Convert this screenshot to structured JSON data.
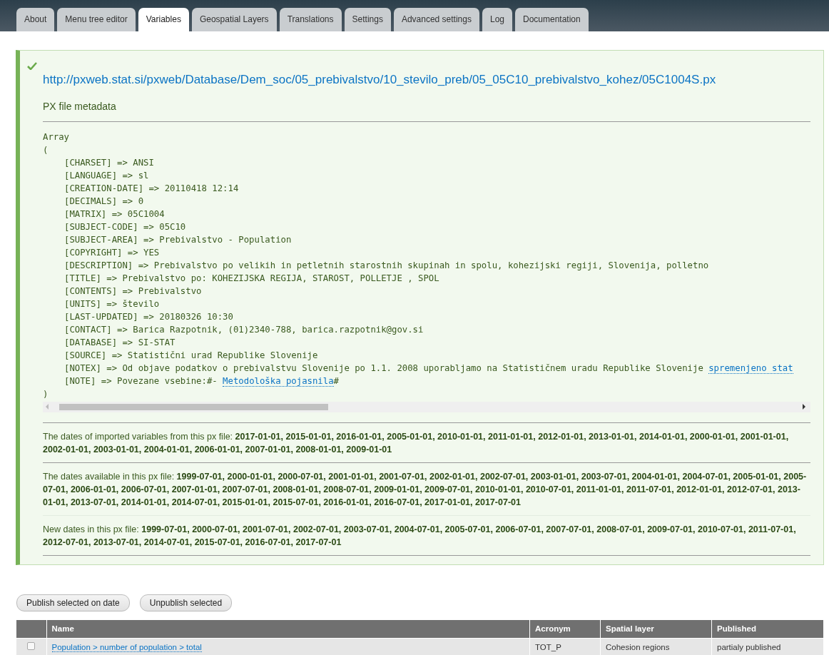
{
  "tabs": [
    {
      "label": "About",
      "selected": false
    },
    {
      "label": "Menu tree editor",
      "selected": false
    },
    {
      "label": "Variables",
      "selected": true
    },
    {
      "label": "Geospatial Layers",
      "selected": false
    },
    {
      "label": "Translations",
      "selected": false
    },
    {
      "label": "Settings",
      "selected": false
    },
    {
      "label": "Advanced settings",
      "selected": false
    },
    {
      "label": "Log",
      "selected": false
    },
    {
      "label": "Documentation",
      "selected": false
    }
  ],
  "message": {
    "url": "http://pxweb.stat.si/pxweb/Database/Dem_soc/05_prebivalstvo/10_stevilo_preb/05_05C10_prebivalstvo_kohez/05C1004S.px",
    "heading": "PX file metadata",
    "dump": {
      "open_lines": [
        "Array",
        "("
      ],
      "entries": [
        {
          "text": "[CHARSET] => ANSI"
        },
        {
          "text": "[LANGUAGE] => sl"
        },
        {
          "text": "[CREATION-DATE] => 20110418 12:14"
        },
        {
          "text": "[DECIMALS] => 0"
        },
        {
          "text": "[MATRIX] => 05C1004"
        },
        {
          "text": "[SUBJECT-CODE] => 05C10"
        },
        {
          "text": "[SUBJECT-AREA] => Prebivalstvo - Population"
        },
        {
          "text": "[COPYRIGHT] => YES"
        },
        {
          "text": "[DESCRIPTION] => Prebivalstvo po velikih in petletnih starostnih skupinah in spolu, kohezijski regiji, Slovenija, polletno"
        },
        {
          "text": "[TITLE] => Prebivalstvo po: KOHEZIJSKA REGIJA, STAROST, POLLETJE , SPOL"
        },
        {
          "text": "[CONTENTS] => Prebivalstvo"
        },
        {
          "text": "[UNITS] => število"
        },
        {
          "text": "[LAST-UPDATED] => 20180326 10:30"
        },
        {
          "text": "[CONTACT] => Barica Razpotnik, (01)2340-788, barica.razpotnik@gov.si"
        },
        {
          "text": "[DATABASE] => SI-STAT"
        },
        {
          "text": "[SOURCE] => Statistični urad Republike Slovenije"
        },
        {
          "text": "[NOTEX] => Od objave podatkov o prebivalstvu Slovenije po 1.1. 2008 uporabljamo na Statističnem uradu Republike Slovenije",
          "link": "spremenjeno stat"
        },
        {
          "text": "[NOTE] => Povezane vsebine:#-",
          "link": "Metodološka pojasnila",
          "tail": "#"
        }
      ],
      "close_line": ")"
    },
    "date_sections": [
      {
        "label": "The dates of imported variables from this px file:",
        "dates": "2017-01-01, 2015-01-01, 2016-01-01, 2005-01-01, 2010-01-01, 2011-01-01, 2012-01-01, 2013-01-01, 2014-01-01, 2000-01-01, 2001-01-01, 2002-01-01, 2003-01-01, 2004-01-01, 2006-01-01, 2007-01-01, 2008-01-01, 2009-01-01"
      },
      {
        "label": "The dates available in this px file:",
        "dates": "1999-07-01, 2000-01-01, 2000-07-01, 2001-01-01, 2001-07-01, 2002-01-01, 2002-07-01, 2003-01-01, 2003-07-01, 2004-01-01, 2004-07-01, 2005-01-01, 2005-07-01, 2006-01-01, 2006-07-01, 2007-01-01, 2007-07-01, 2008-01-01, 2008-07-01, 2009-01-01, 2009-07-01, 2010-01-01, 2010-07-01, 2011-01-01, 2011-07-01, 2012-01-01, 2012-07-01, 2013-01-01, 2013-07-01, 2014-01-01, 2014-07-01, 2015-01-01, 2015-07-01, 2016-01-01, 2016-07-01, 2017-01-01, 2017-07-01"
      },
      {
        "label": "New dates in this px file:",
        "dates": "1999-07-01, 2000-07-01, 2001-07-01, 2002-07-01, 2003-07-01, 2004-07-01, 2005-07-01, 2006-07-01, 2007-07-01, 2008-07-01, 2009-07-01, 2010-07-01, 2011-07-01, 2012-07-01, 2013-07-01, 2014-07-01, 2015-07-01, 2016-07-01, 2017-07-01"
      }
    ]
  },
  "buttons": [
    "Publish selected on date",
    "Unpublish selected"
  ],
  "table": {
    "columns": [
      "Name",
      "Acronym",
      "Spatial layer",
      "Published"
    ],
    "rows": [
      {
        "checked": false,
        "name": "Population > number of population > total",
        "acronym": "TOT_P",
        "spatial_layer": "Cohesion regions",
        "published": "partialy published"
      }
    ]
  }
}
